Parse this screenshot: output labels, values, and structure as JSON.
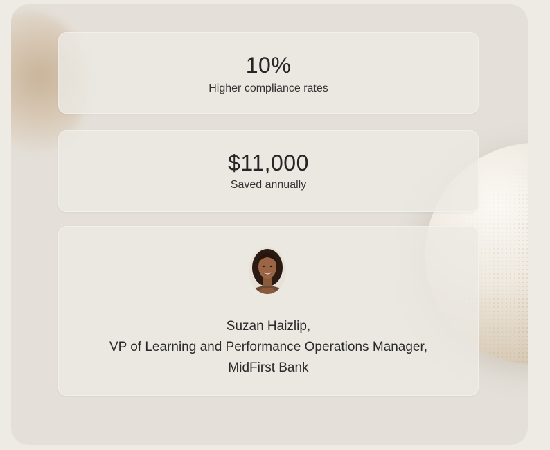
{
  "stats": [
    {
      "value": "10%",
      "label": "Higher compliance rates"
    },
    {
      "value": "$11,000",
      "label": "Saved annually"
    }
  ],
  "testimonial": {
    "avatar_icon": "person-portrait-icon",
    "name": "Suzan Haizlip,",
    "title": "VP of Learning and Performance Operations Manager,",
    "company": "MidFirst Bank"
  },
  "colors": {
    "background": "#eeebe4",
    "panel": "#e4e0d9",
    "card": "#ece9e3",
    "text": "#2b2b2b"
  }
}
